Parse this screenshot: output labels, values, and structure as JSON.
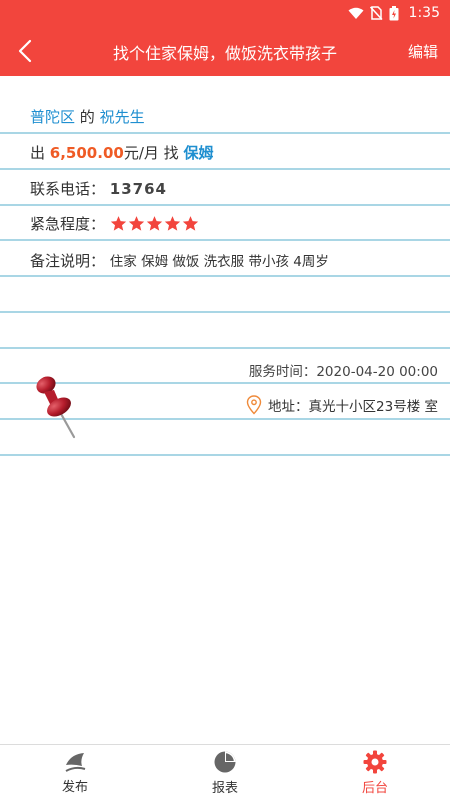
{
  "status_bar": {
    "time": "1:35"
  },
  "app_bar": {
    "title": "找个住家保姆，做饭洗衣带孩子",
    "edit_label": "编辑"
  },
  "post": {
    "district": "普陀区",
    "of": "的",
    "contact_name": "祝先生",
    "pay_prefix": "出",
    "salary": "6,500.00",
    "salary_unit": "元/月",
    "find": "找",
    "job_type": "保姆",
    "phone_label": "联系电话：",
    "phone_value": "13764",
    "urgency_label": "紧急程度：",
    "urgency_stars": 5,
    "note_label": "备注说明：",
    "note_value": "住家 保姆 做饭 洗衣服 带小孩 4周岁",
    "service_time_label": "服务时间：",
    "service_time_value": "2020-04-20 00:00",
    "address_label": "地址：",
    "address_value": "真光十小区23号楼",
    "address_suffix": "室"
  },
  "bottom_nav": {
    "items": [
      {
        "label": "发布",
        "icon": "publish-icon",
        "active": false
      },
      {
        "label": "报表",
        "icon": "pie-chart-icon",
        "active": false
      },
      {
        "label": "后台",
        "icon": "gear-icon",
        "active": true
      }
    ]
  },
  "colors": {
    "primary": "#f2453d",
    "accent_blue": "#1f8fd0",
    "salary_orange": "#ef5b25",
    "rule_line": "#a9d6e5"
  }
}
